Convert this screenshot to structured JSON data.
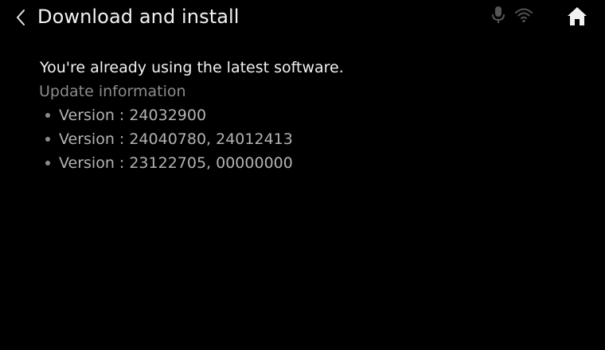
{
  "header": {
    "back_icon": "chevron-left-icon",
    "title": "Download and install",
    "status_icons": [
      "mic-icon",
      "wifi-icon"
    ],
    "home_icon": "home-icon"
  },
  "main": {
    "status_message": "You're already using the latest software.",
    "update_info_heading": "Update information",
    "versions": [
      "Version : 24032900",
      "Version : 24040780, 24012413",
      "Version : 23122705, 00000000"
    ]
  },
  "colors": {
    "background": "#000000",
    "primary_text": "#f2f2f2",
    "secondary_text": "#8c8c8c",
    "list_text": "#b3b3b3",
    "inactive_icon": "#555555"
  }
}
